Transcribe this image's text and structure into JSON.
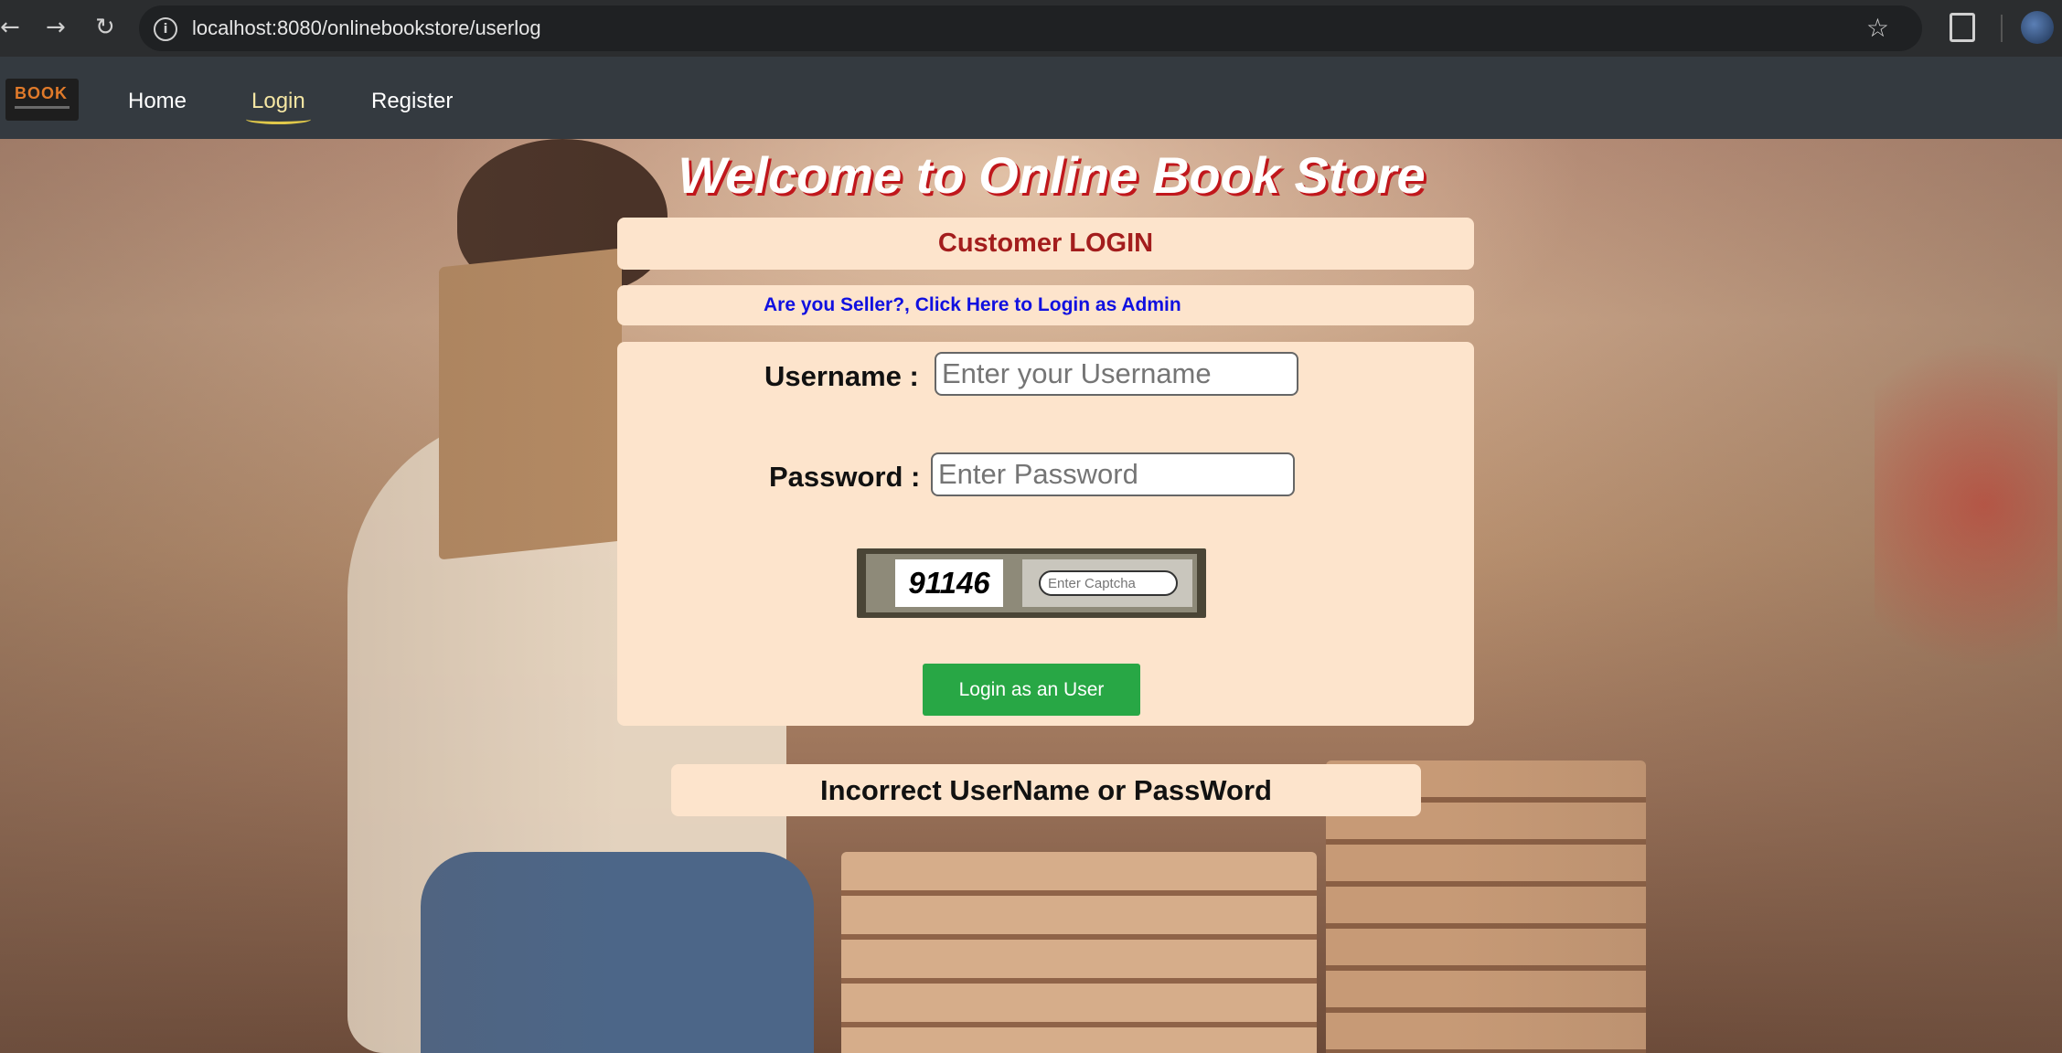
{
  "browser": {
    "back_glyph": "←",
    "forward_glyph": "→",
    "reload_glyph": "↻",
    "info_glyph": "i",
    "url": "localhost:8080/onlinebookstore/userlog",
    "star_glyph": "☆"
  },
  "navbar": {
    "logo_text": "BOOK",
    "links": [
      {
        "label": "Home"
      },
      {
        "label": "Login",
        "active": true
      },
      {
        "label": "Register"
      }
    ]
  },
  "page": {
    "headline": "Welcome to Online Book Store",
    "login_title": "Customer LOGIN",
    "seller_link": "Are you Seller?, Click Here to Login as Admin"
  },
  "form": {
    "username_label": "Username :",
    "username_placeholder": "Enter your Username",
    "username_value": "",
    "password_label": "Password :",
    "password_placeholder": "Enter Password",
    "password_value": "",
    "captcha_code": "91146",
    "captcha_placeholder": "Enter Captcha",
    "submit_label": "Login as an User"
  },
  "message": {
    "error": "Incorrect UserName or PassWord"
  },
  "colors": {
    "navbar_bg": "#343a40",
    "panel_bg": "#fde4cc",
    "title_red": "#a31d1d",
    "link_blue": "#1010e0",
    "button_green": "#28a745"
  }
}
